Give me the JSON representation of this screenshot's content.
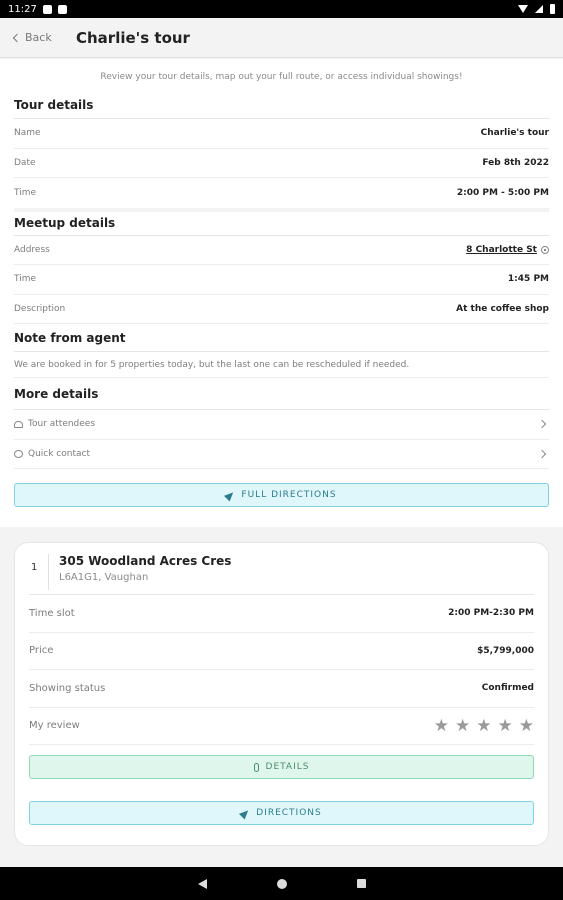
{
  "status_bar": {
    "time": "11:27"
  },
  "header": {
    "back_label": "Back",
    "title": "Charlie's tour"
  },
  "intro": "Review your tour details, map out your full route, or access individual showings!",
  "tour_details": {
    "title": "Tour details",
    "rows": [
      {
        "label": "Name",
        "value": "Charlie's tour"
      },
      {
        "label": "Date",
        "value": "Feb 8th 2022"
      },
      {
        "label": "Time",
        "value": "2:00 PM - 5:00 PM"
      }
    ]
  },
  "meetup_details": {
    "title": "Meetup details",
    "address_label": "Address",
    "address_value": "8 Charlotte St",
    "time_label": "Time",
    "time_value": "1:45 PM",
    "description_label": "Description",
    "description_value": "At the coffee shop"
  },
  "agent_note": {
    "title": "Note from agent",
    "text": "We are booked in for 5 properties today, but the last one can be rescheduled if needed."
  },
  "more_details": {
    "title": "More details",
    "items": [
      {
        "label": "Tour attendees",
        "icon": "people-icon"
      },
      {
        "label": "Quick contact",
        "icon": "chat-bubble-icon"
      }
    ]
  },
  "full_directions_label": "FULL DIRECTIONS",
  "showing": {
    "number": "1",
    "street": "305 Woodland Acres Cres",
    "city": "L6A1G1, Vaughan",
    "time_slot_label": "Time slot",
    "time_slot_value": "2:00 PM-2:30 PM",
    "price_label": "Price",
    "price_value": "$5,799,000",
    "status_label": "Showing status",
    "status_value": "Confirmed",
    "review_label": "My review",
    "stars": [
      "★",
      "★",
      "★",
      "★",
      "★"
    ],
    "details_label": "DETAILS",
    "directions_label": "DIRECTIONS"
  },
  "colors": {
    "accent_blue_bg": "#dff6fb",
    "accent_blue_border": "#7fd2e3",
    "accent_green_bg": "#dff6ec",
    "accent_green_border": "#8fd9b3"
  }
}
